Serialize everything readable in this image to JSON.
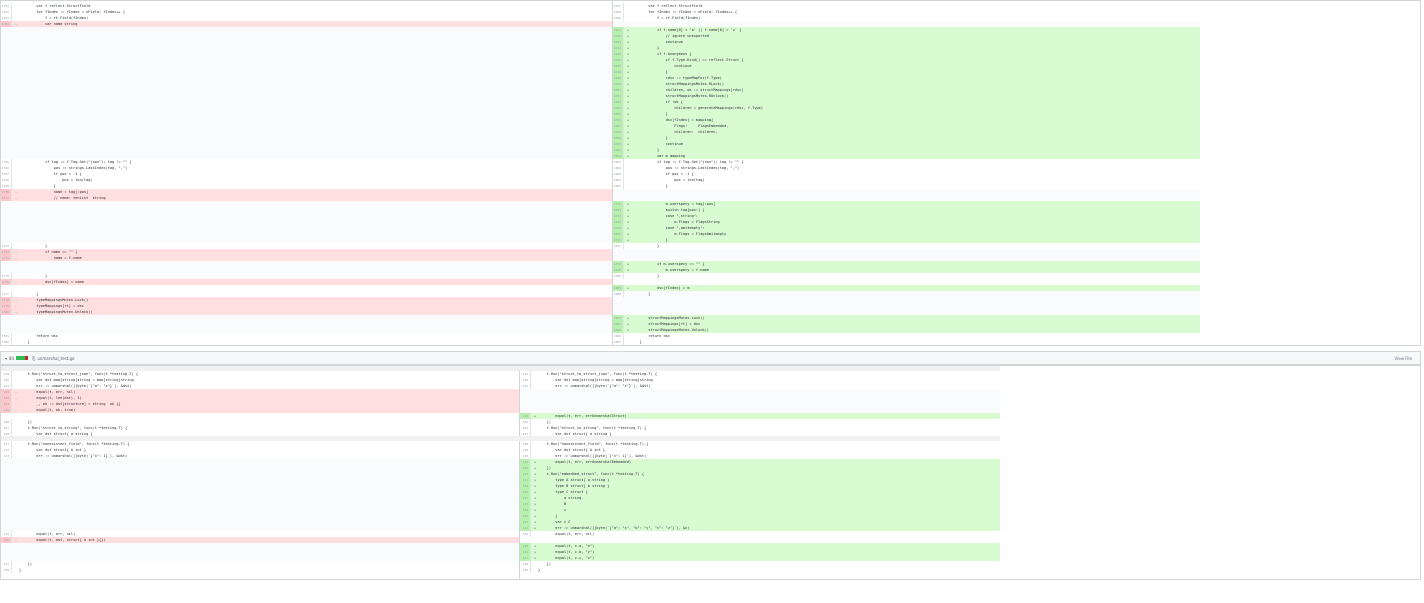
{
  "file1": {
    "left_rows": [
      {
        "ln": "1761",
        "type": "ctx",
        "code": "        var f reflect.StructField"
      },
      {
        "ln": "1762",
        "type": "ctx",
        "code": "        for fIndex := fIndex < nField; fIndex++ {"
      },
      {
        "ln": "1763",
        "type": "ctx",
        "code": "            f = rt.Field(fIndex)"
      },
      {
        "ln": "1764",
        "type": "del",
        "code": "            var name string"
      }
    ],
    "left_rows_b": [
      {
        "ln": "1765",
        "type": "ctx",
        "code": "            if tag := f.Tag.Get(\"json\"); tag != \"\" {"
      },
      {
        "ln": "1766",
        "type": "ctx",
        "code": "                pos := strings.LastIndex(tag, \",\")"
      },
      {
        "ln": "1767",
        "type": "ctx",
        "code": "                if pos > -1 {"
      },
      {
        "ln": "1768",
        "type": "ctx",
        "code": "                    pos = len(tag)"
      },
      {
        "ln": "1769",
        "type": "ctx",
        "code": "                }"
      },
      {
        "ln": "1770",
        "type": "del",
        "code": "                name = tag[:pos]"
      },
      {
        "ln": "1771",
        "type": "del",
        "code": "                // name: tenList  string"
      }
    ],
    "left_rows_c": [
      {
        "ln": "1772",
        "type": "ctx",
        "code": "            }"
      },
      {
        "ln": "1773",
        "type": "del",
        "code": "            if name == \"\" {"
      },
      {
        "ln": "1774",
        "type": "del",
        "code": "                name = f.name"
      }
    ],
    "left_rows_d": [
      {
        "ln": "1775",
        "type": "ctx",
        "code": "            }"
      },
      {
        "ln": "1776",
        "type": "del",
        "code": "            dsc[fIndex] = name"
      }
    ],
    "left_rows_e": [
      {
        "ln": "1777",
        "type": "ctx",
        "code": "        }"
      },
      {
        "ln": "1778",
        "type": "del",
        "code": "        typeMappingsMutex.Lock()"
      },
      {
        "ln": "1779",
        "type": "del",
        "code": "        typeMappings[rt] = dsc"
      },
      {
        "ln": "1780",
        "type": "del",
        "code": "        typeMappingsMutex.Unlock()"
      }
    ],
    "left_rows_f": [
      {
        "ln": "1781",
        "type": "ctx",
        "code": "        return dsc"
      },
      {
        "ln": "1782",
        "type": "ctx",
        "code": "    }"
      }
    ],
    "right_rows_a": [
      {
        "ln": "1037",
        "type": "ctx",
        "code": "        var f reflect.StructField"
      },
      {
        "ln": "1038",
        "type": "ctx",
        "code": "        for fIndex := fIndex < nField; fIndex++ {"
      },
      {
        "ln": "1039",
        "type": "ctx",
        "code": "            f = rt.Field(fIndex)"
      }
    ],
    "right_rows_b": [
      {
        "ln": "1041",
        "type": "add",
        "code": "            if f.name[0] < 'a' || f.name[0] > 'z' {"
      },
      {
        "ln": "1042",
        "type": "add",
        "code": "                // ignore unexported"
      },
      {
        "ln": "1043",
        "type": "add",
        "code": "                continue"
      },
      {
        "ln": "1044",
        "type": "add",
        "code": "            }"
      },
      {
        "ln": "1045",
        "type": "add",
        "code": "            if f.Anonymous {"
      },
      {
        "ln": "1046",
        "type": "add",
        "code": "                if f.Type.Kind() == reflect.Struct {"
      },
      {
        "ln": "1047",
        "type": "add",
        "code": "                    continue"
      },
      {
        "ln": "1048",
        "type": "add",
        "code": "                }"
      },
      {
        "ln": "1049",
        "type": "add",
        "code": "                rdsc := typeMapFor(f.Type)"
      },
      {
        "ln": "1050",
        "type": "add",
        "code": "                structMappingsMutex.RLock()"
      },
      {
        "ln": "1051",
        "type": "add",
        "code": "                children, ok := structMappings[rdsc]"
      },
      {
        "ln": "1052",
        "type": "add",
        "code": "                structMappingsMutex.RUnlock()"
      },
      {
        "ln": "1053",
        "type": "add",
        "code": "                if !ok {"
      },
      {
        "ln": "1054",
        "type": "add",
        "code": "                    children = generateMappings(rdsc, f.Type)"
      },
      {
        "ln": "1055",
        "type": "add",
        "code": "                }"
      },
      {
        "ln": "1056",
        "type": "add",
        "code": "                dsc[fIndex] = mapping{"
      },
      {
        "ln": "1057",
        "type": "add",
        "code": "                    Flags:     FlagsEmbedded,"
      },
      {
        "ln": "1058",
        "type": "add",
        "code": "                    children:  children,"
      },
      {
        "ln": "1059",
        "type": "add",
        "code": "                }"
      },
      {
        "ln": "1060",
        "type": "add",
        "code": "                continue"
      },
      {
        "ln": "1061",
        "type": "add",
        "code": "            }"
      },
      {
        "ln": "1062",
        "type": "add",
        "code": "            var m mapping"
      }
    ],
    "right_rows_c": [
      {
        "ln": "1063",
        "type": "ctx",
        "code": "            if tag := f.Tag.Get(\"json\"); tag != \"\" {"
      },
      {
        "ln": "1064",
        "type": "ctx",
        "code": "                pos := strings.LastIndex(tag, \",\")"
      },
      {
        "ln": "1065",
        "type": "ctx",
        "code": "                if pos > -1 {"
      },
      {
        "ln": "1066",
        "type": "ctx",
        "code": "                    pos = len(tag)"
      },
      {
        "ln": "1067",
        "type": "ctx",
        "code": "                }"
      }
    ],
    "right_rows_d": [
      {
        "ln": "1070",
        "type": "add",
        "code": "                m.userspecy = tag[:pos]"
      },
      {
        "ln": "1071",
        "type": "add",
        "code": "                switch tag[pos:] {"
      },
      {
        "ln": "1072",
        "type": "add",
        "code": "                case \",string\":"
      },
      {
        "ln": "1073",
        "type": "add",
        "code": "                    m.Flags = FlagsString"
      },
      {
        "ln": "1074",
        "type": "add",
        "code": "                case \",omitempty\":"
      },
      {
        "ln": "1075",
        "type": "add",
        "code": "                    m.Flags = FlagsOmitempty"
      },
      {
        "ln": "1076",
        "type": "add",
        "code": "                }"
      },
      {
        "ln": "1077",
        "type": "ctx",
        "code": "            }"
      }
    ],
    "right_rows_e": [
      {
        "ln": "1078",
        "type": "add",
        "code": "            if m.userspecy == \"\" {"
      },
      {
        "ln": "1079",
        "type": "add",
        "code": "                m.userspecy = f.name"
      },
      {
        "ln": "1080",
        "type": "ctx",
        "code": "            }"
      }
    ],
    "right_rows_f": [
      {
        "ln": "1081",
        "type": "add",
        "code": "            dsc[fIndex] = m"
      },
      {
        "ln": "1082",
        "type": "ctx",
        "code": "        }"
      }
    ],
    "right_rows_g": [
      {
        "ln": "1083",
        "type": "add",
        "code": "        structMappingsMutex.Lock()"
      },
      {
        "ln": "1084",
        "type": "add",
        "code": "        structMappings[rt] = dsc"
      },
      {
        "ln": "1085",
        "type": "add",
        "code": "        structMappingsMutex.Unlock()"
      },
      {
        "ln": "1086",
        "type": "ctx",
        "code": "        return dsc"
      },
      {
        "ln": "1087",
        "type": "ctx",
        "code": "    }"
      }
    ]
  },
  "file2": {
    "header": {
      "chevron": "▾",
      "count": "84",
      "copy_icon": "⎘",
      "filename": "unmarshal_test.go",
      "view_file": "View File"
    },
    "left_rows_a": [
      {
        "ln": "119",
        "type": "ctx",
        "code": "    t.Run(\"struct_to_struct_json\", func(t *testing.T) {"
      },
      {
        "ln": "120",
        "type": "ctx",
        "code": "        var dst map[string]string = map[string]string"
      },
      {
        "ln": "121",
        "type": "ctx",
        "code": "        err := unmarshal([]byte(`{\"a\": \"x\"}`), &dst)"
      },
      {
        "ln": "122",
        "type": "del",
        "code": "        equal(t, err, nil)"
      },
      {
        "ln": "123",
        "type": "del",
        "code": "        equal(t, len(dst), 1)"
      },
      {
        "ln": "124",
        "type": "del",
        "code": "        _, ok := dst[structure] = string  ok {}"
      },
      {
        "ln": "125",
        "type": "del",
        "code": "        equal(t, ok, true)"
      }
    ],
    "left_rows_b": [
      {
        "ln": "126",
        "type": "ctx",
        "code": "    })"
      },
      {
        "ln": "127",
        "type": "ctx",
        "code": "    t.Run(\"struct_to_string\", func(t *testing.T) {"
      },
      {
        "ln": "128",
        "type": "ctx",
        "code": "        var dst struct{ a string }"
      }
    ],
    "left_rows_c": [
      {
        "ln": "131",
        "type": "ctx",
        "code": "    t.Run(\"nonexistent_field\", func(t *testing.T) {"
      },
      {
        "ln": "132",
        "type": "ctx",
        "code": "        var dst struct{ A int }"
      },
      {
        "ln": "133",
        "type": "ctx",
        "code": "        err := unmarshal([]byte(`{\"x\": 1}`), &dst)"
      }
    ],
    "left_rows_d": [
      {
        "ln": "135",
        "type": "ctx",
        "code": "        equal(t, err, nil)"
      },
      {
        "ln": "136",
        "type": "del",
        "code": "        equal(t, dst, struct{ A int }{})"
      }
    ],
    "left_rows_e": [
      {
        "ln": "137",
        "type": "ctx",
        "code": "    })"
      },
      {
        "ln": "138",
        "type": "ctx",
        "code": "}"
      }
    ],
    "right_rows_a": [
      {
        "ln": "119",
        "type": "ctx",
        "code": "    t.Run(\"struct_to_struct_json\", func(t *testing.T) {"
      },
      {
        "ln": "120",
        "type": "ctx",
        "code": "        var dst map[string]string = map[string]string"
      },
      {
        "ln": "121",
        "type": "ctx",
        "code": "        err := unmarshal([]byte(`{\"a\": \"x\"}`), &dst)"
      }
    ],
    "right_rows_b": [
      {
        "ln": "122",
        "type": "add",
        "code": "        equal(t, err, errUnmarshalStruct)"
      },
      {
        "ln": "123",
        "type": "ctx",
        "code": "    })"
      },
      {
        "ln": "124",
        "type": "ctx",
        "code": "    t.Run(\"struct_to_string\", func(t *testing.T) {"
      },
      {
        "ln": "125",
        "type": "ctx",
        "code": "        var dst struct{ a string }"
      }
    ],
    "right_rows_c": [
      {
        "ln": "128",
        "type": "ctx",
        "code": "    t.Run(\"nonexistent_field\", func(t *testing.T) {"
      },
      {
        "ln": "129",
        "type": "ctx",
        "code": "        var dst struct{ A int }"
      },
      {
        "ln": "130",
        "type": "ctx",
        "code": "        err := unmarshal([]byte(`{\"x\": 1}`), &dst)"
      },
      {
        "ln": "131",
        "type": "add",
        "code": "        equal(t, err, errUnmarshalEmbedded)"
      },
      {
        "ln": "132",
        "type": "add",
        "code": "    })"
      },
      {
        "ln": "133",
        "type": "add",
        "code": "    t.Run(\"embedded_struct\", func(t *testing.T) {"
      },
      {
        "ln": "134",
        "type": "add",
        "code": "        type A struct{ a string }"
      },
      {
        "ln": "135",
        "type": "add",
        "code": "        type B struct{ b string }"
      },
      {
        "ln": "136",
        "type": "add",
        "code": "        type C struct {"
      },
      {
        "ln": "137",
        "type": "add",
        "code": "            a string"
      },
      {
        "ln": "138",
        "type": "add",
        "code": "            B"
      },
      {
        "ln": "139",
        "type": "add",
        "code": "            c"
      },
      {
        "ln": "140",
        "type": "add",
        "code": "        }"
      },
      {
        "ln": "141",
        "type": "add",
        "code": "        var c C"
      },
      {
        "ln": "142",
        "type": "add",
        "code": "        err := unmarshal([]byte(`{\"a\": \"x\", \"b\": \"y\", \"c\": \"z\"}`), &c)"
      },
      {
        "ln": "143",
        "type": "ctx",
        "code": "        equal(t, err, nil)"
      }
    ],
    "right_rows_d": [
      {
        "ln": "145",
        "type": "add",
        "code": "        equal(t, c.a, \"x\")"
      },
      {
        "ln": "146",
        "type": "add",
        "code": "        equal(t, c.b, \"y\")"
      },
      {
        "ln": "147",
        "type": "add",
        "code": "        equal(t, c.c, \"z\")"
      }
    ],
    "right_rows_e": [
      {
        "ln": "148",
        "type": "ctx",
        "code": "    })"
      },
      {
        "ln": "149",
        "type": "ctx",
        "code": "}"
      }
    ]
  }
}
